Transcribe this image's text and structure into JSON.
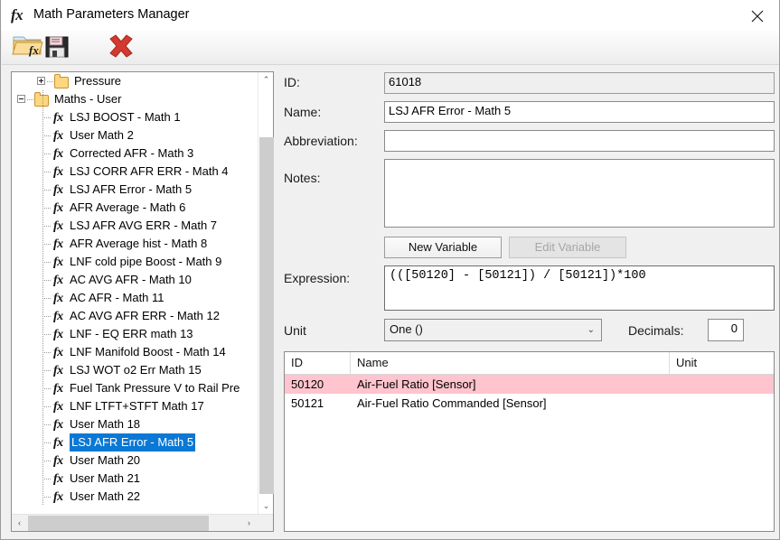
{
  "window": {
    "title": "Math Parameters Manager",
    "title_icon": "fx-icon",
    "close_label": "close-icon"
  },
  "toolbar": {
    "open_label": "open-math-folder-icon",
    "save_label": "save-icon",
    "delete_label": "delete-icon"
  },
  "tree": {
    "items": [
      {
        "label": "Pressure",
        "type": "folder",
        "indent": 1,
        "expander": "plus",
        "selected": false
      },
      {
        "label": "Maths - User",
        "type": "folder",
        "indent": 0,
        "expander": "minus",
        "selected": false
      },
      {
        "label": "LSJ BOOST - Math 1",
        "type": "fx",
        "indent": 1,
        "expander": "none",
        "selected": false
      },
      {
        "label": "User Math 2",
        "type": "fx",
        "indent": 1,
        "expander": "none",
        "selected": false
      },
      {
        "label": "Corrected AFR - Math 3",
        "type": "fx",
        "indent": 1,
        "expander": "none",
        "selected": false
      },
      {
        "label": "LSJ CORR AFR ERR - Math 4",
        "type": "fx",
        "indent": 1,
        "expander": "none",
        "selected": false
      },
      {
        "label": "LSJ AFR Error - Math 5",
        "type": "fx",
        "indent": 1,
        "expander": "none",
        "selected": false
      },
      {
        "label": "AFR Average - Math 6",
        "type": "fx",
        "indent": 1,
        "expander": "none",
        "selected": false
      },
      {
        "label": "LSJ AFR AVG ERR - Math 7",
        "type": "fx",
        "indent": 1,
        "expander": "none",
        "selected": false
      },
      {
        "label": "AFR Average hist - Math 8",
        "type": "fx",
        "indent": 1,
        "expander": "none",
        "selected": false
      },
      {
        "label": "LNF cold pipe Boost - Math 9",
        "type": "fx",
        "indent": 1,
        "expander": "none",
        "selected": false
      },
      {
        "label": "AC AVG AFR - Math 10",
        "type": "fx",
        "indent": 1,
        "expander": "none",
        "selected": false
      },
      {
        "label": "AC AFR - Math 11",
        "type": "fx",
        "indent": 1,
        "expander": "none",
        "selected": false
      },
      {
        "label": "AC AVG AFR ERR - Math 12",
        "type": "fx",
        "indent": 1,
        "expander": "none",
        "selected": false
      },
      {
        "label": "LNF - EQ ERR math 13",
        "type": "fx",
        "indent": 1,
        "expander": "none",
        "selected": false
      },
      {
        "label": "LNF Manifold Boost - Math 14",
        "type": "fx",
        "indent": 1,
        "expander": "none",
        "selected": false
      },
      {
        "label": "LSJ WOT o2 Err Math 15",
        "type": "fx",
        "indent": 1,
        "expander": "none",
        "selected": false
      },
      {
        "label": "Fuel Tank Pressure V to Rail Pre",
        "type": "fx",
        "indent": 1,
        "expander": "none",
        "selected": false
      },
      {
        "label": "LNF LTFT+STFT Math 17",
        "type": "fx",
        "indent": 1,
        "expander": "none",
        "selected": false
      },
      {
        "label": "User Math 18",
        "type": "fx",
        "indent": 1,
        "expander": "none",
        "selected": false
      },
      {
        "label": "LSJ AFR Error - Math 5",
        "type": "fx",
        "indent": 1,
        "expander": "none",
        "selected": true
      },
      {
        "label": "User Math 20",
        "type": "fx",
        "indent": 1,
        "expander": "none",
        "selected": false
      },
      {
        "label": "User Math 21",
        "type": "fx",
        "indent": 1,
        "expander": "none",
        "selected": false
      },
      {
        "label": "User Math 22",
        "type": "fx",
        "indent": 1,
        "expander": "none",
        "selected": false
      }
    ],
    "scroll_up": "⌃",
    "scroll_down": "⌄",
    "scroll_left": "‹",
    "scroll_right": "›"
  },
  "form": {
    "id_label": "ID:",
    "id_value": "61018",
    "name_label": "Name:",
    "name_value": "LSJ AFR Error - Math 5",
    "abbreviation_label": "Abbreviation:",
    "abbreviation_value": "",
    "notes_label": "Notes:",
    "notes_value": "",
    "new_variable_label": "New Variable",
    "edit_variable_label": "Edit Variable",
    "expression_label": "Expression:",
    "expression_value": "(([50120] - [50121]) / [50121])*100",
    "unit_label": "Unit",
    "unit_value": "One ()",
    "unit_arrow": "⌄",
    "decimals_label": "Decimals:",
    "decimals_value": "0"
  },
  "variables_table": {
    "columns": [
      "ID",
      "Name",
      "Unit"
    ],
    "rows": [
      {
        "id": "50120",
        "name": "Air-Fuel Ratio [Sensor]",
        "unit": "",
        "highlight": true
      },
      {
        "id": "50121",
        "name": "Air-Fuel Ratio Commanded [Sensor]",
        "unit": "",
        "highlight": false
      }
    ]
  },
  "colors": {
    "selection_blue": "#0a78d4",
    "row_highlight_pink": "#ffc4ce",
    "window_bg": "#f0f0f0",
    "folder_yellow": "#fcd77f"
  }
}
